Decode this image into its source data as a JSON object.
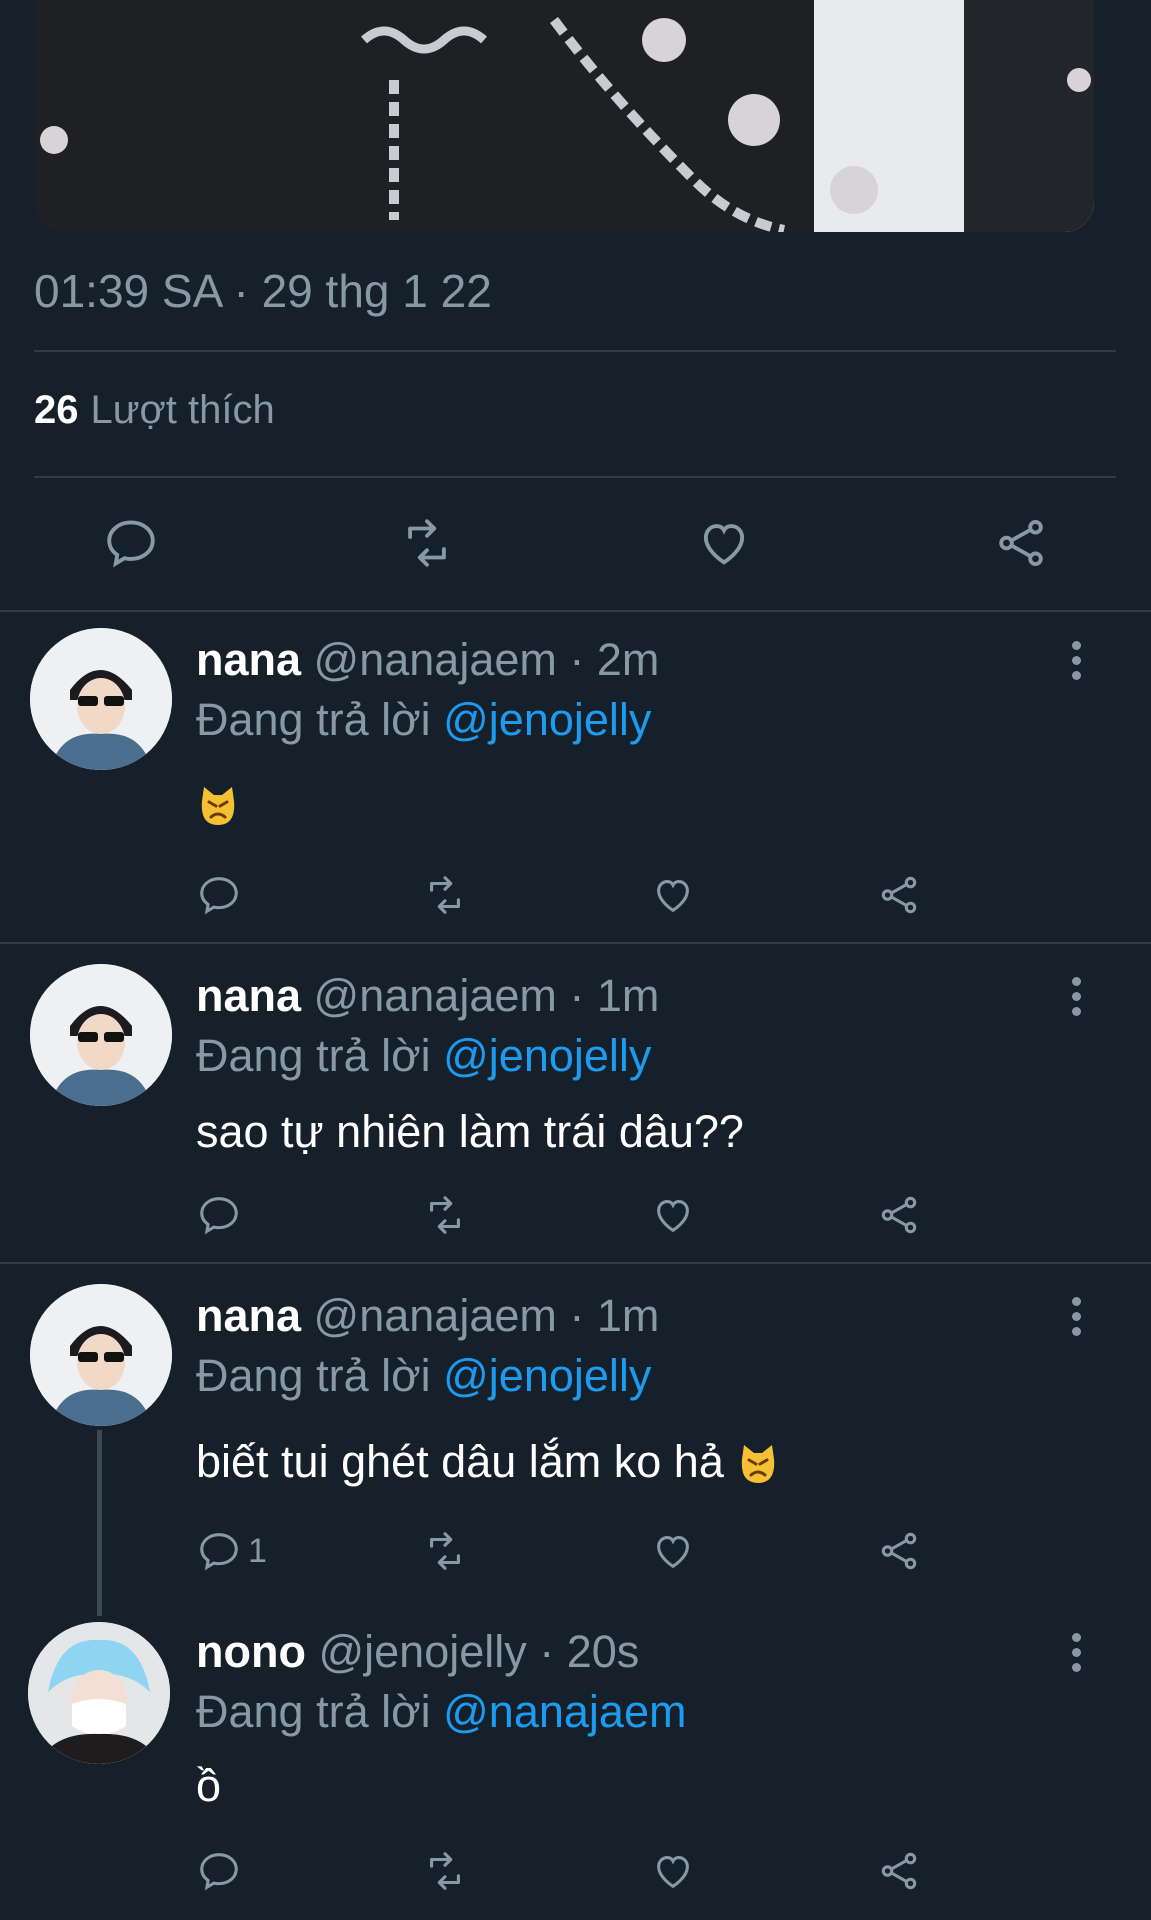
{
  "tweet": {
    "timestamp": "01:39 SA · 29 thg 1 22",
    "likes_count": "26",
    "likes_label": "Lượt thích"
  },
  "replies": [
    {
      "display_name": "nana",
      "meta": "@nanajaem · 2m",
      "reply_prefix": "Đang trả lời",
      "mention": "@jenojelly",
      "text": "",
      "emoji": "angry-cat-emoji",
      "reply_count": ""
    },
    {
      "display_name": "nana",
      "meta": "@nanajaem · 1m",
      "reply_prefix": "Đang trả lời",
      "mention": "@jenojelly",
      "text": "sao tự nhiên làm trái dâu??",
      "reply_count": ""
    },
    {
      "display_name": "nana",
      "meta": "@nanajaem · 1m",
      "reply_prefix": "Đang trả lời",
      "mention": "@jenojelly",
      "text": "biết tui ghét dâu lắm ko hả",
      "emoji": "angry-cat-emoji",
      "reply_count": "1"
    },
    {
      "display_name": "nono",
      "meta": "@jenojelly · 20s",
      "reply_prefix": "Đang trả lời",
      "mention": "@nanajaem",
      "text": "ồ",
      "reply_count": ""
    }
  ],
  "colors": {
    "background": "#15202b",
    "secondary_text": "#8899a6",
    "accent": "#1d9bf0",
    "divider": "#2f3b47"
  }
}
